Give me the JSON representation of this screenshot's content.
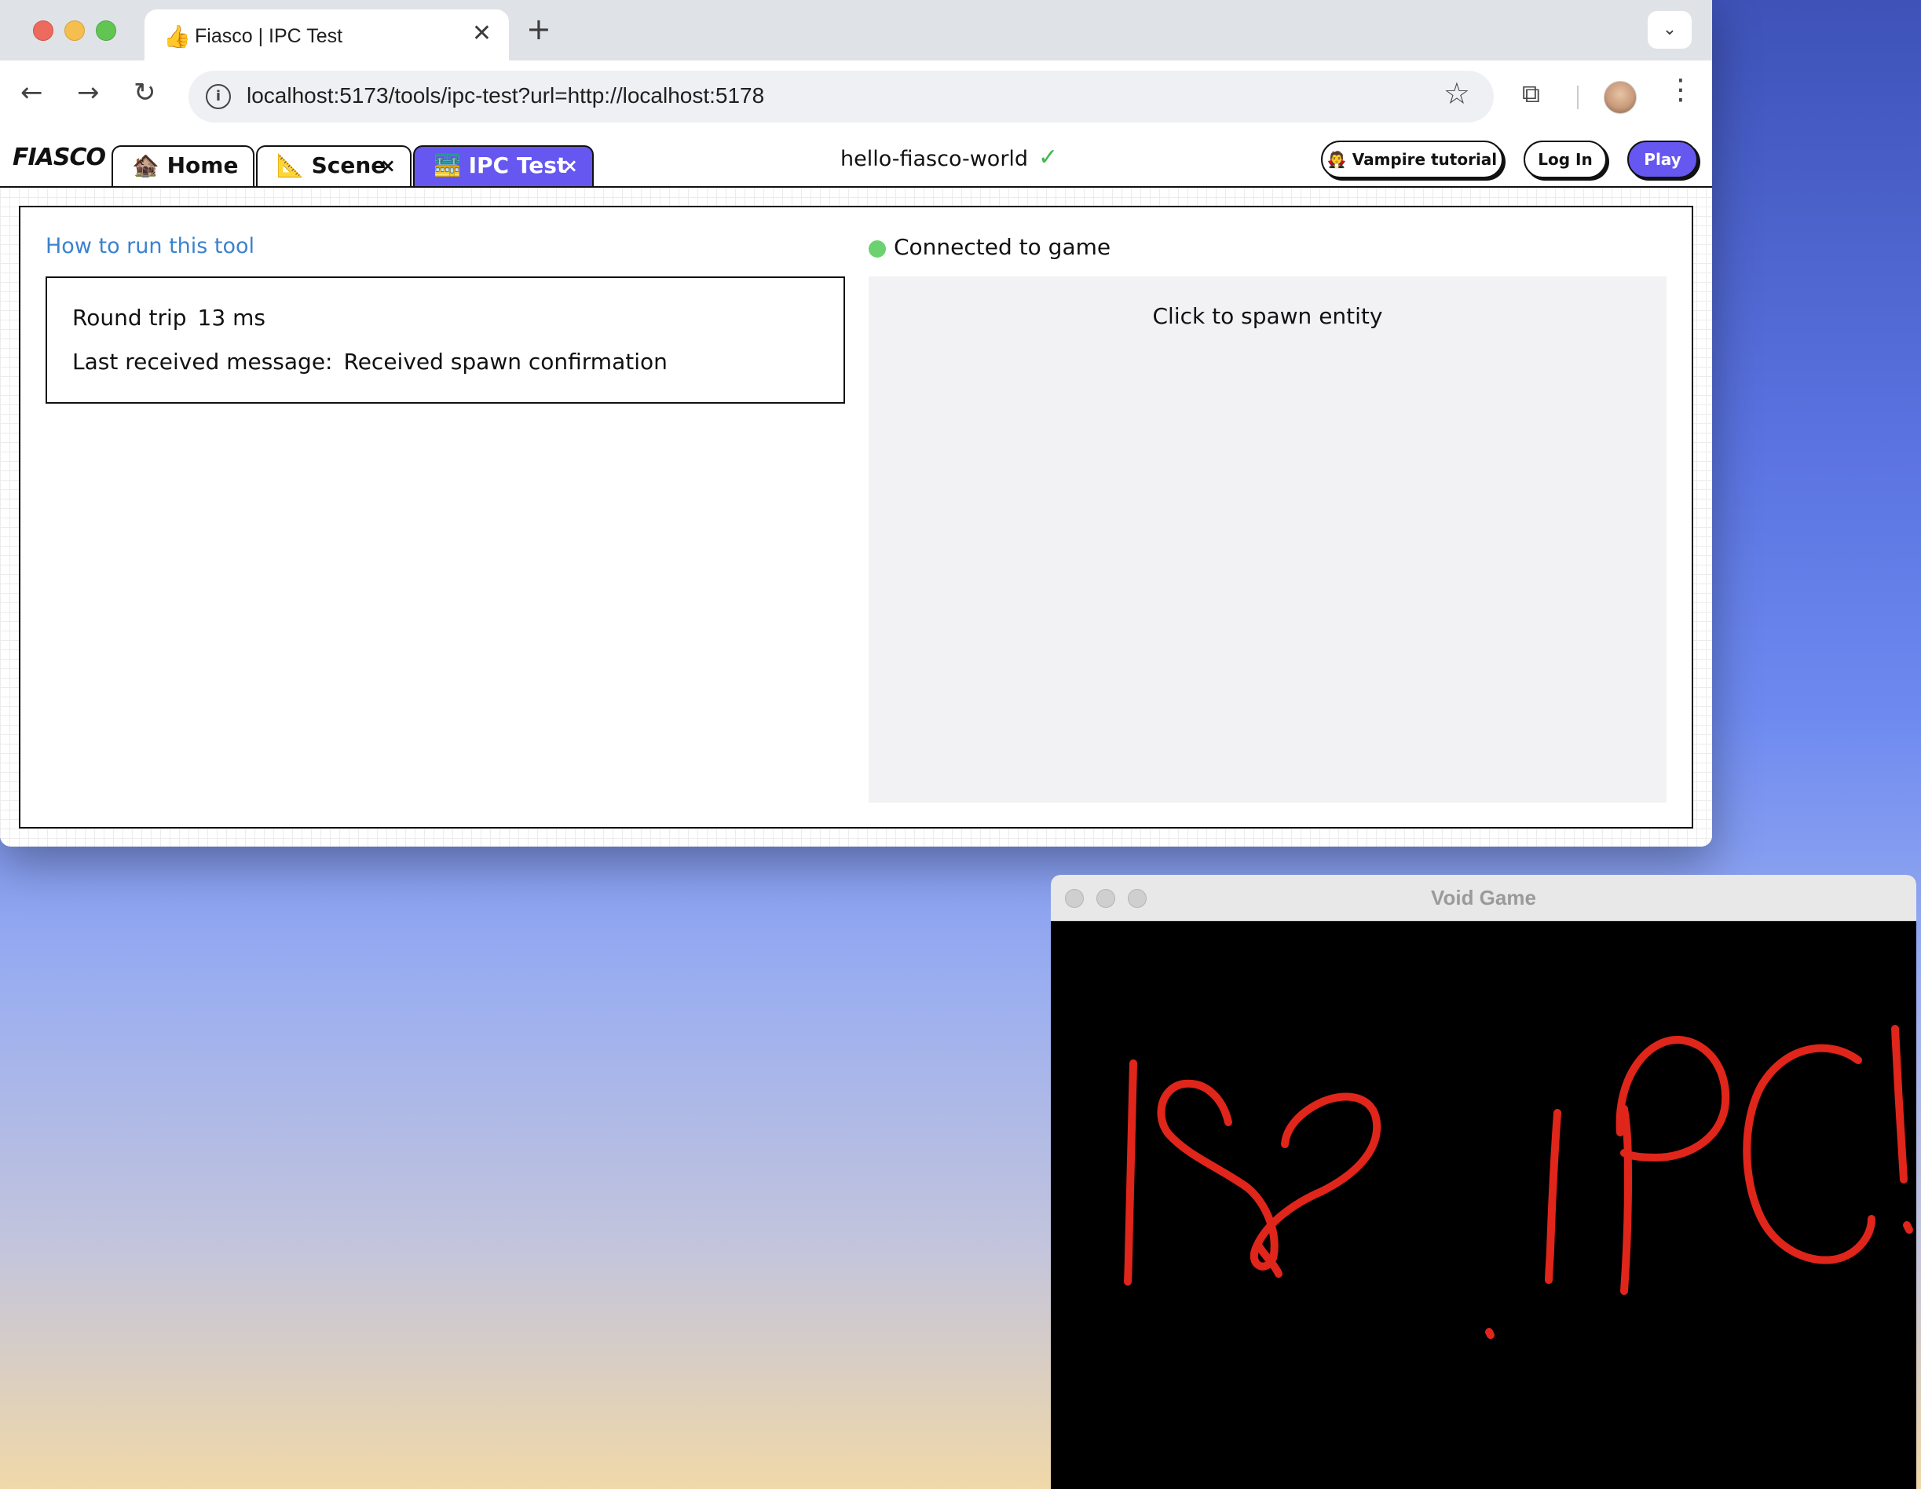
{
  "browser": {
    "tab_title": "Fiasco | IPC Test",
    "tab_close": "✕",
    "new_tab": "+",
    "url": "localhost:5173/tools/ipc-test?url=http://localhost:5178"
  },
  "app": {
    "logo": "FIASCO",
    "tabs": [
      {
        "label": "🏚️ Home"
      },
      {
        "label": "📐 Scene",
        "close": "×"
      },
      {
        "label": "🚟 IPC Test",
        "close": "×"
      }
    ],
    "project_name": "hello-fiasco-world",
    "project_status": "✓",
    "buttons": {
      "vampire": "🧛 Vampire tutorial",
      "login": "Log In",
      "play": "Play"
    }
  },
  "ipc_tool": {
    "howto_link": "How to run this tool",
    "round_trip_label": "Round trip",
    "round_trip_value": "13 ms",
    "last_message_label": "Last received message:",
    "last_message_value": "Received spawn confirmation",
    "connection_status": "Connected to game",
    "connection_color": "#6cd16f",
    "spawn_prompt": "Click to spawn entity"
  },
  "game_window": {
    "title": "Void Game",
    "canvas_text": "I ❤ IPC!",
    "stroke_color": "#e0251b"
  }
}
